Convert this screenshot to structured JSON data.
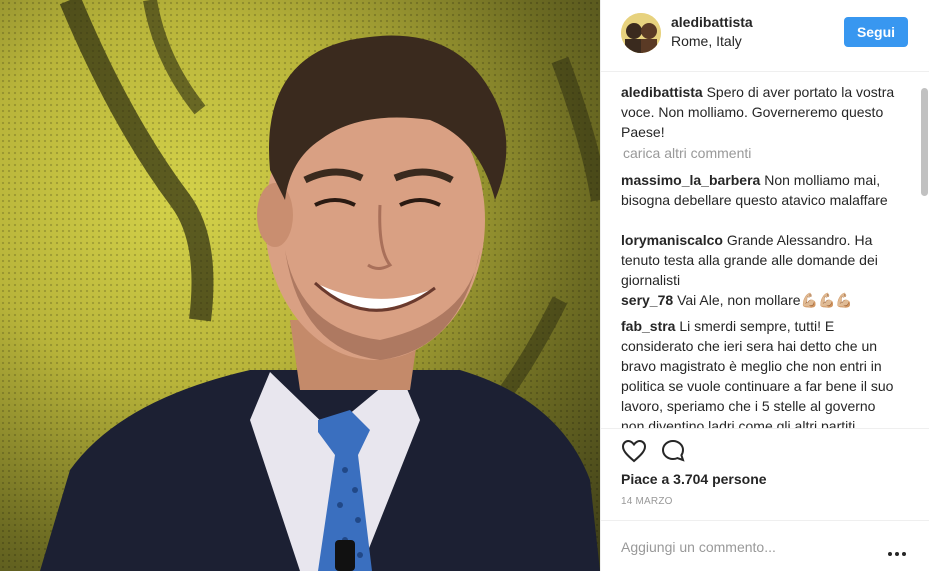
{
  "post": {
    "photo_subject": "man-smiling-portrait",
    "header": {
      "username": "aledibattista",
      "location": "Rome, Italy",
      "follow_label": "Segui"
    },
    "caption": {
      "user": "aledibattista",
      "text": "Spero di aver portato la vostra voce. Non molliamo. Governeremo questo Paese!"
    },
    "load_more_label": "carica altri commenti",
    "comments": [
      {
        "user": "massimo_la_barbera",
        "text": "Non molliamo mai, bisogna debellare questo atavico malaffare"
      },
      {
        "user": "lorymaniscalco",
        "text": "Grande Alessandro. Ha tenuto testa alla grande alle domande dei giornalisti"
      },
      {
        "user": "sery_78",
        "text": "Vai Ale, non mollare💪🏼💪🏼💪🏼"
      },
      {
        "user": "fab_stra",
        "text": "Li smerdi sempre, tutti! E considerato che ieri sera hai detto che un bravo magistrato è meglio che non entri in politica se vuole continuare a far bene il suo lavoro, speriamo che i 5 stelle al governo non diventino ladri come gli altri partiti"
      }
    ],
    "likes_text": "Piace a 3.704 persone",
    "date": "14 MARZO",
    "add_comment_placeholder": "Aggiungi un commento...",
    "icons": {
      "like": "heart-icon",
      "comment": "comment-icon",
      "more": "more-options-icon"
    },
    "colors": {
      "follow_button": "#3897f0",
      "muted_text": "#999999",
      "border": "#efefef"
    }
  }
}
